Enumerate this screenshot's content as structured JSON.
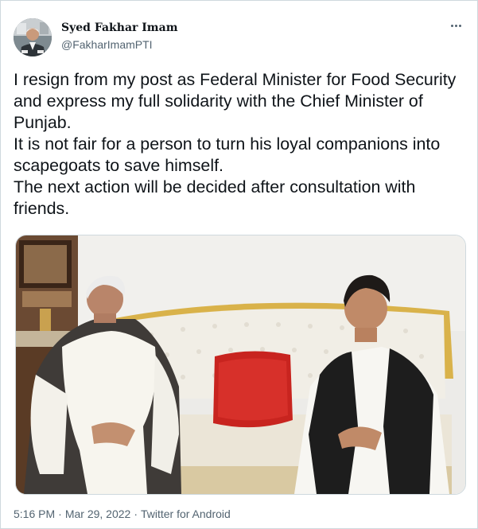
{
  "author": {
    "display_name": "Syed Fakhar Imam",
    "handle": "@FakharImamPTI"
  },
  "tweet": {
    "lines": [
      "I resign from my post as Federal Minister for Food Security and express my full solidarity with the Chief Minister of Punjab.",
      "It is not fair for a person to turn his loyal companions into scapegoats to save himself.",
      "The next action will be decided after consultation with friends."
    ]
  },
  "meta": {
    "time": "5:16 PM",
    "date": "Mar 29, 2022",
    "source": "Twitter for Android",
    "separator": "·"
  },
  "icons": {
    "more": "more-options-icon",
    "avatar": "profile-avatar"
  },
  "colors": {
    "text_primary": "#0f1419",
    "text_secondary": "#536471",
    "border": "#cfd9de"
  }
}
